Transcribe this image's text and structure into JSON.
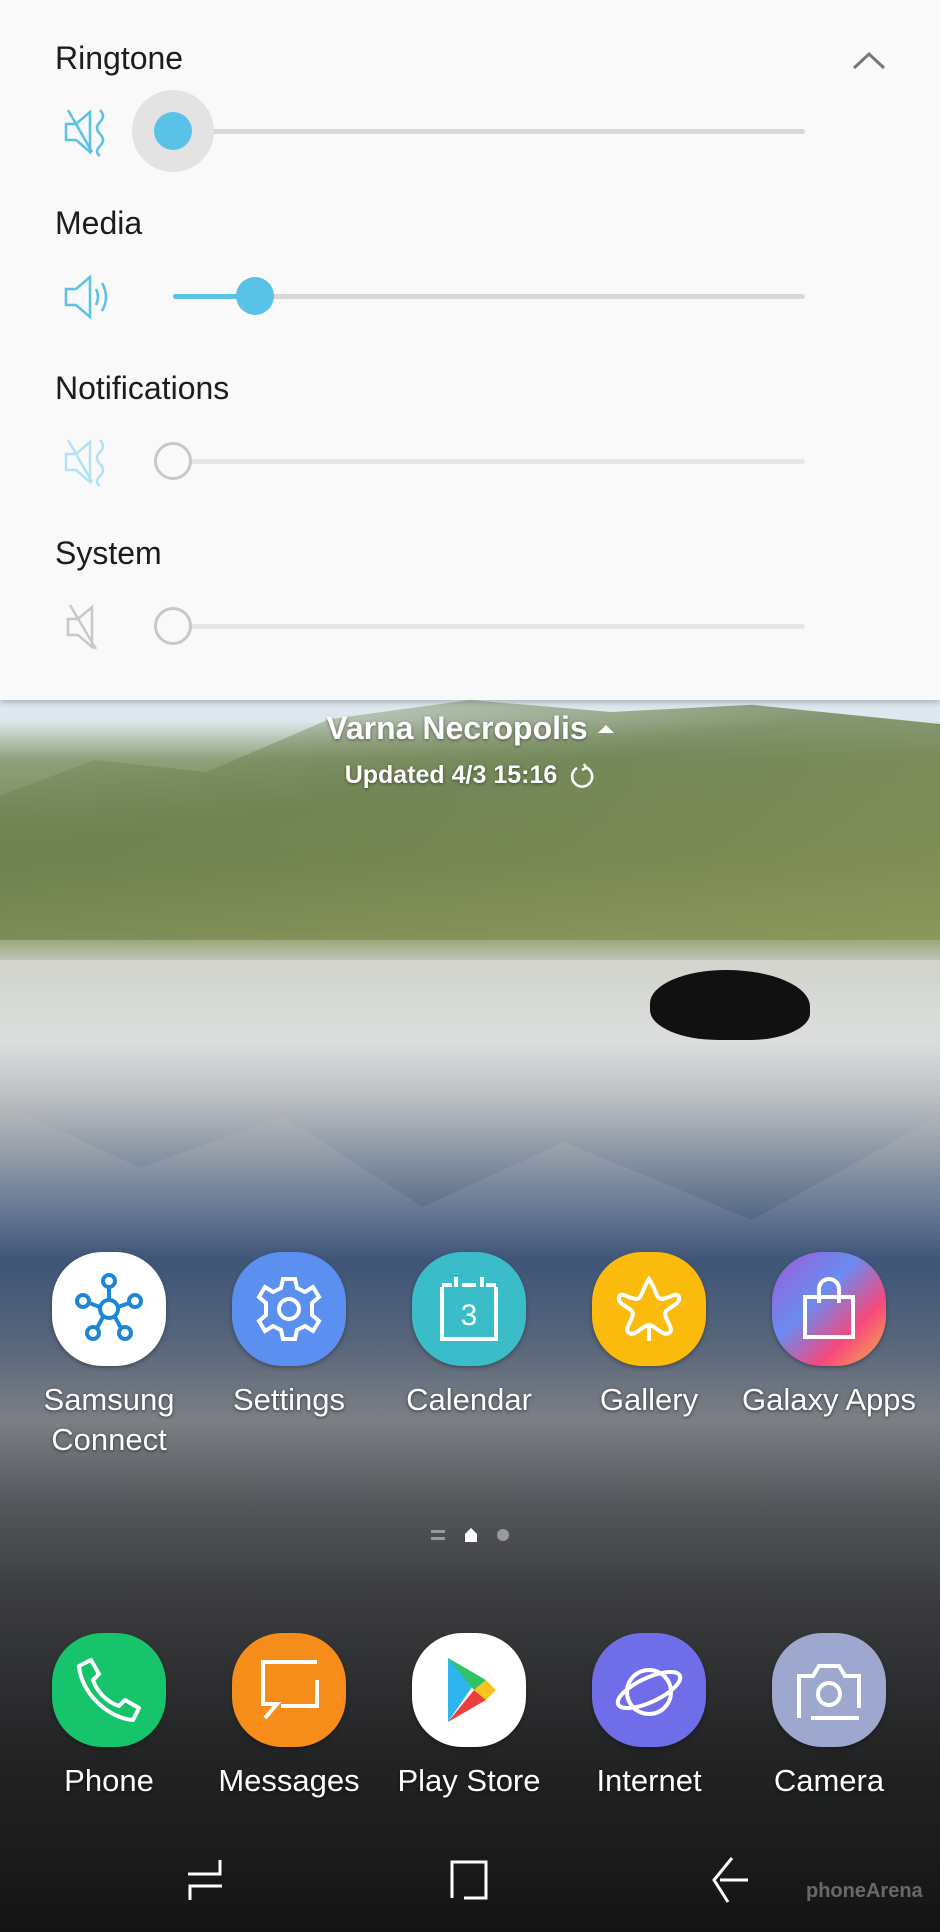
{
  "volume_panel": {
    "collapse_icon": "chevron-up-icon",
    "sliders": [
      {
        "label": "Ringtone",
        "icon": "vibrate-mute-icon",
        "value_percent": 0,
        "state": "active-focused"
      },
      {
        "label": "Media",
        "icon": "speaker-icon",
        "value_percent": 13,
        "state": "active"
      },
      {
        "label": "Notifications",
        "icon": "vibrate-mute-icon",
        "value_percent": 0,
        "state": "inactive"
      },
      {
        "label": "System",
        "icon": "speaker-mute-icon",
        "value_percent": 0,
        "state": "inactive"
      }
    ],
    "accent_color": "#59c2e6"
  },
  "weather": {
    "location": "Varna Necropolis",
    "updated": "Updated 4/3 15:16",
    "refresh_icon": "refresh-icon"
  },
  "home_apps": [
    {
      "label": "Samsung\nConnect",
      "icon": "samsung-connect-icon",
      "color": "#ffffff"
    },
    {
      "label": "Settings",
      "icon": "gear-icon",
      "color": "#5b8ff0"
    },
    {
      "label": "Calendar",
      "icon": "calendar-icon",
      "color": "#3bbcc9",
      "day": "3"
    },
    {
      "label": "Gallery",
      "icon": "gallery-flower-icon",
      "color": "#fbbb0c"
    },
    {
      "label": "Galaxy Apps",
      "icon": "shopping-bag-icon",
      "color": "#b45ad0"
    }
  ],
  "page_indicator": {
    "pages": [
      "menu",
      "home",
      "page"
    ],
    "current": "home"
  },
  "dock_apps": [
    {
      "label": "Phone",
      "icon": "phone-icon",
      "color": "#16c46c"
    },
    {
      "label": "Messages",
      "icon": "message-bubble-icon",
      "color": "#f68c1a"
    },
    {
      "label": "Play Store",
      "icon": "play-store-icon",
      "color": "#ffffff"
    },
    {
      "label": "Internet",
      "icon": "planet-icon",
      "color": "#6f6ee8"
    },
    {
      "label": "Camera",
      "icon": "camera-icon",
      "color": "#9ea8cf"
    }
  ],
  "navbar": {
    "recents": "recents-icon",
    "home": "home-button-icon",
    "back": "back-arrow-icon"
  },
  "watermark": "phoneArena"
}
